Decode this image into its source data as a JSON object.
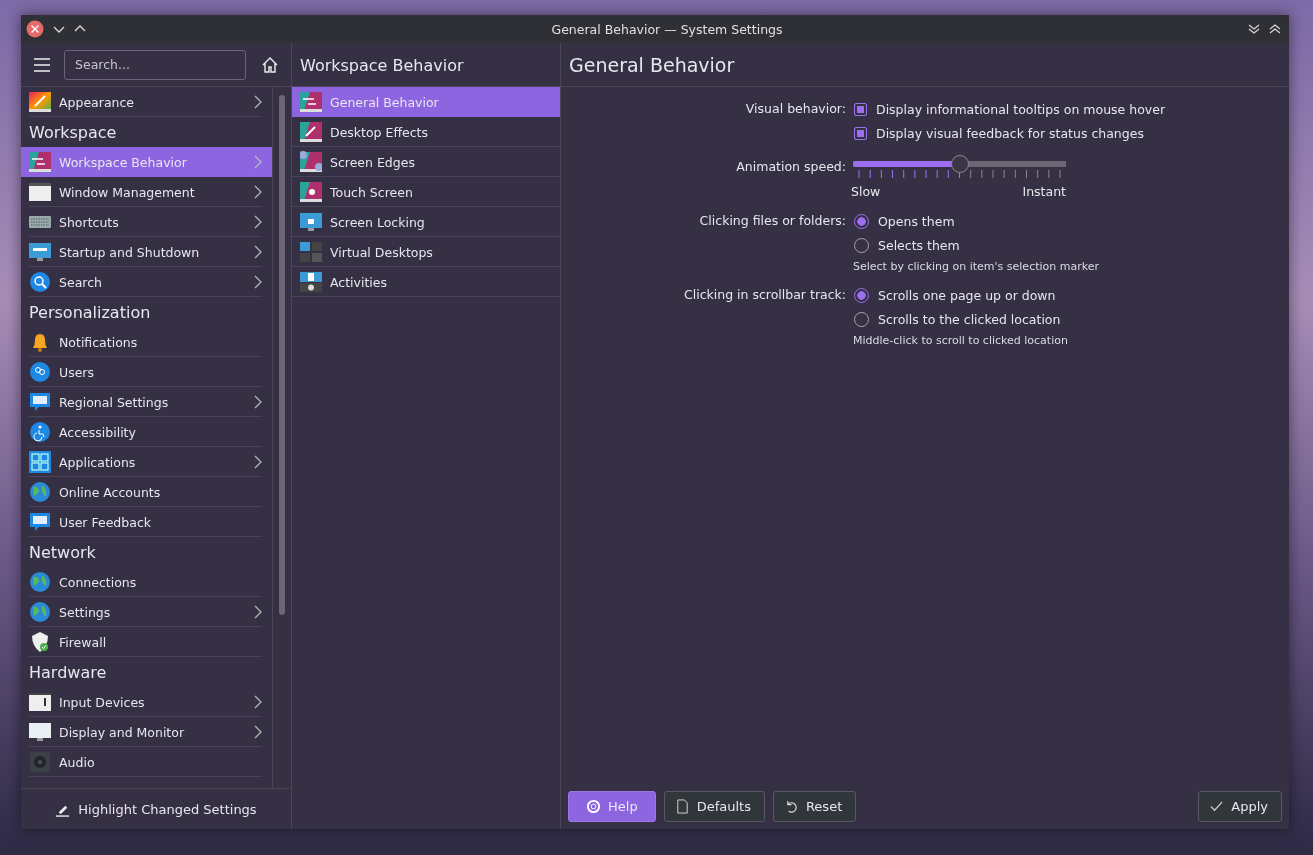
{
  "window": {
    "title": "General Behavior — System Settings"
  },
  "sidebar": {
    "search": {
      "placeholder": "Search..."
    },
    "sections": [
      {
        "items": [
          {
            "label": "Appearance",
            "expandable": true,
            "selected": false
          }
        ]
      },
      {
        "title": "Workspace",
        "items": [
          {
            "label": "Workspace Behavior",
            "expandable": true,
            "selected": true
          },
          {
            "label": "Window Management",
            "expandable": true,
            "selected": false
          },
          {
            "label": "Shortcuts",
            "expandable": true,
            "selected": false
          },
          {
            "label": "Startup and Shutdown",
            "expandable": true,
            "selected": false
          },
          {
            "label": "Search",
            "expandable": true,
            "selected": false
          }
        ]
      },
      {
        "title": "Personalization",
        "items": [
          {
            "label": "Notifications",
            "expandable": false,
            "selected": false
          },
          {
            "label": "Users",
            "expandable": false,
            "selected": false
          },
          {
            "label": "Regional Settings",
            "expandable": true,
            "selected": false
          },
          {
            "label": "Accessibility",
            "expandable": false,
            "selected": false
          },
          {
            "label": "Applications",
            "expandable": true,
            "selected": false
          },
          {
            "label": "Online Accounts",
            "expandable": false,
            "selected": false
          },
          {
            "label": "User Feedback",
            "expandable": false,
            "selected": false
          }
        ]
      },
      {
        "title": "Network",
        "items": [
          {
            "label": "Connections",
            "expandable": false,
            "selected": false
          },
          {
            "label": "Settings",
            "expandable": true,
            "selected": false
          },
          {
            "label": "Firewall",
            "expandable": false,
            "selected": false
          }
        ]
      },
      {
        "title": "Hardware",
        "items": [
          {
            "label": "Input Devices",
            "expandable": true,
            "selected": false
          },
          {
            "label": "Display and Monitor",
            "expandable": true,
            "selected": false
          },
          {
            "label": "Audio",
            "expandable": false,
            "selected": false
          }
        ]
      }
    ],
    "footer_button": "Highlight Changed Settings"
  },
  "subpanel": {
    "title": "Workspace Behavior",
    "items": [
      {
        "label": "General Behavior",
        "selected": true
      },
      {
        "label": "Desktop Effects",
        "selected": false
      },
      {
        "label": "Screen Edges",
        "selected": false
      },
      {
        "label": "Touch Screen",
        "selected": false
      },
      {
        "label": "Screen Locking",
        "selected": false
      },
      {
        "label": "Virtual Desktops",
        "selected": false
      },
      {
        "label": "Activities",
        "selected": false
      }
    ]
  },
  "page": {
    "title": "General Behavior",
    "rows": [
      {
        "kind": "checkboxes",
        "label": "Visual behavior:",
        "options": [
          {
            "label": "Display informational tooltips on mouse hover",
            "checked": true
          },
          {
            "label": "Display visual feedback for status changes",
            "checked": true
          }
        ]
      },
      {
        "kind": "slider",
        "label": "Animation speed:",
        "level": 0.5,
        "min_label": "Slow",
        "max_label": "Instant"
      },
      {
        "kind": "radios",
        "label": "Clicking files or folders:",
        "options": [
          {
            "label": "Opens them",
            "selected": true
          },
          {
            "label": "Selects them",
            "selected": false
          }
        ],
        "note": "Select by clicking on item's selection marker"
      },
      {
        "kind": "radios",
        "label": "Clicking in scrollbar track:",
        "options": [
          {
            "label": "Scrolls one page up or down",
            "selected": true
          },
          {
            "label": "Scrolls to the clicked location",
            "selected": false
          }
        ],
        "note": "Middle-click to scroll to clicked location"
      }
    ]
  },
  "buttons": [
    {
      "kind": "help",
      "label": "Help",
      "highlighted": true
    },
    {
      "kind": "defaults",
      "label": "Defaults",
      "highlighted": false
    },
    {
      "kind": "reset",
      "label": "Reset",
      "highlighted": false
    },
    {
      "kind": "apply",
      "label": "Apply",
      "highlighted": false
    }
  ]
}
